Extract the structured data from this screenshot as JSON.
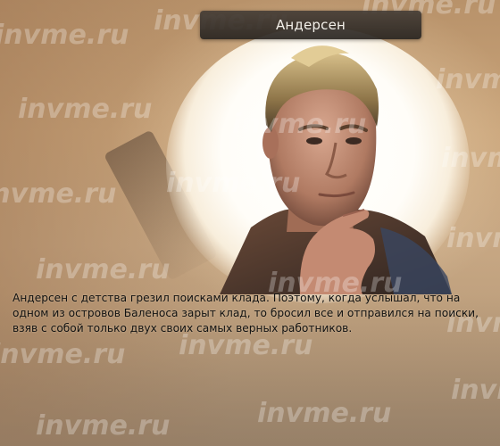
{
  "dialog": {
    "character_name": "Андерсен",
    "story": "Андерсен с детства грезил поисками клада. Поэтому, когда услышал, что на одном из островов Баленоса зарыт клад, то бросил все и отправился на поиски, взяв с собой только двух своих самых верных работников."
  },
  "watermark": {
    "text": "invme.ru"
  },
  "colors": {
    "title_bar": "#3a342f",
    "title_text": "#f4f1ea",
    "story_text": "#111111",
    "background": "#c9a47a"
  }
}
